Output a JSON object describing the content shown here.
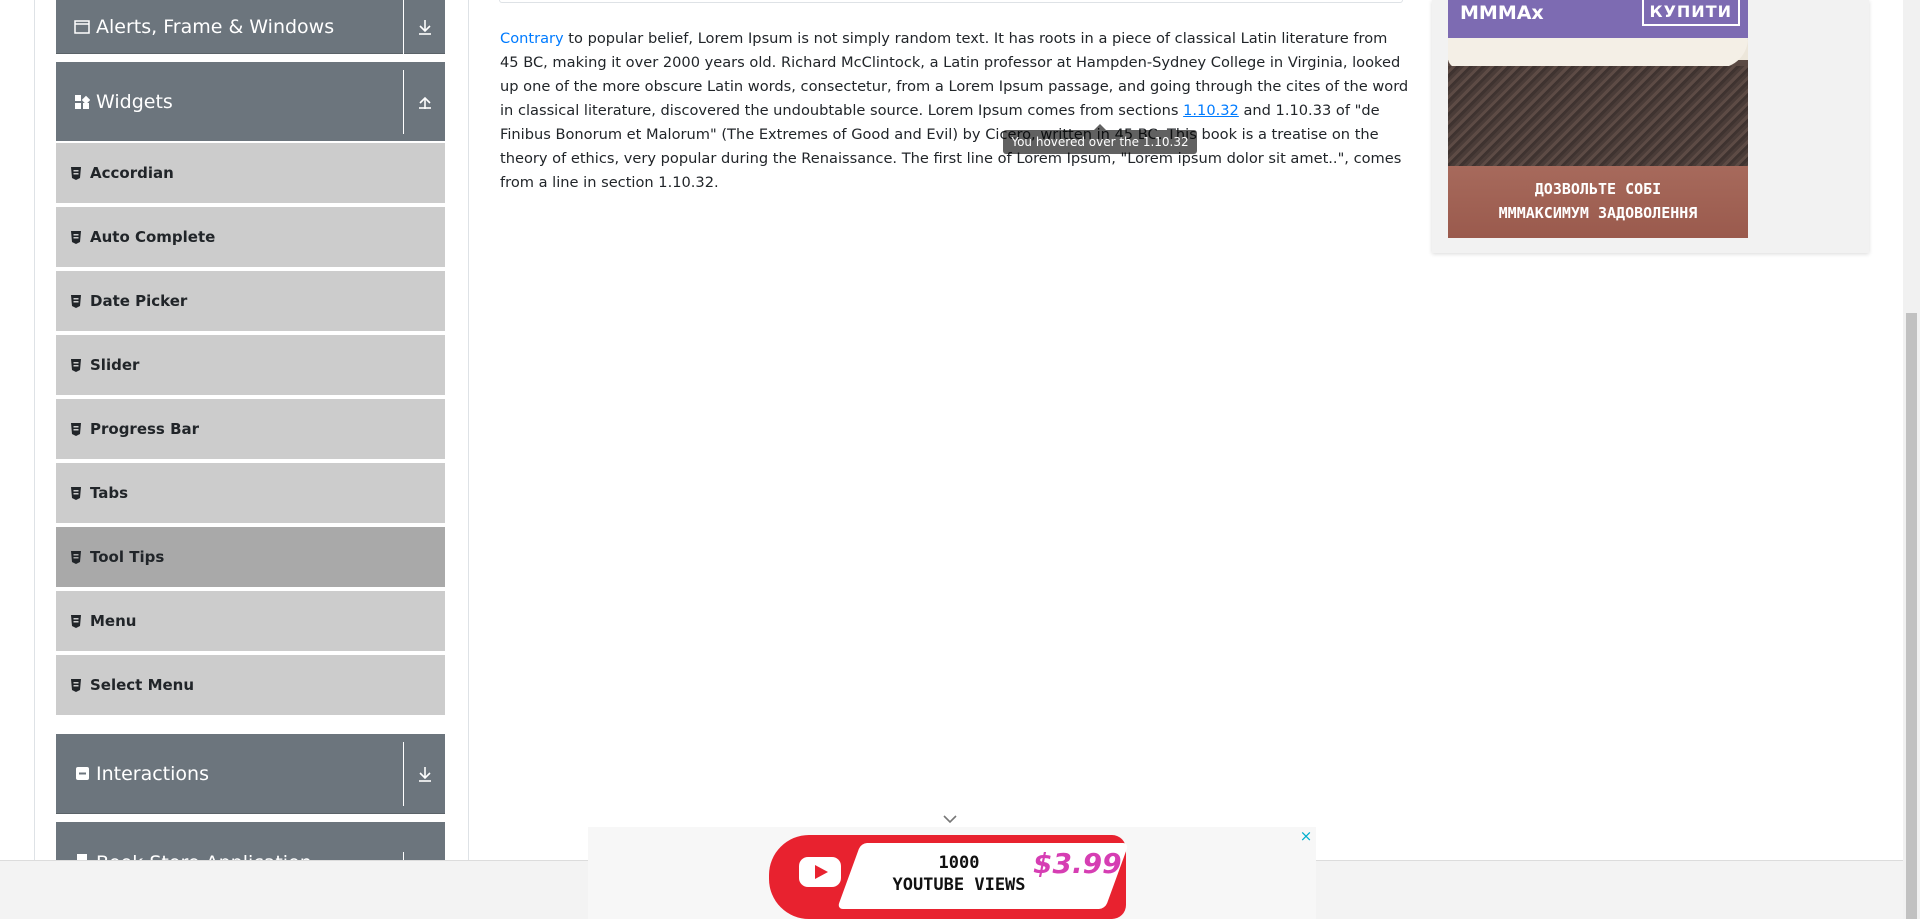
{
  "sidebar": {
    "groups": [
      {
        "label": "Alerts, Frame & Windows",
        "icon": "window-icon",
        "toggle": "expand-down-icon"
      },
      {
        "label": "Widgets",
        "icon": "widgets-icon",
        "toggle": "collapse-up-icon"
      },
      {
        "label": "Interactions",
        "icon": "interactions-icon",
        "toggle": "expand-down-icon"
      },
      {
        "label": "Book Store Application",
        "icon": "book-icon",
        "toggle": "expand-down-icon"
      }
    ],
    "items": [
      {
        "label": "Accordian"
      },
      {
        "label": "Auto Complete"
      },
      {
        "label": "Date Picker"
      },
      {
        "label": "Slider"
      },
      {
        "label": "Progress Bar"
      },
      {
        "label": "Tabs"
      },
      {
        "label": "Tool Tips",
        "active": true
      },
      {
        "label": "Menu"
      },
      {
        "label": "Select Menu"
      }
    ]
  },
  "content": {
    "blue_word": "Contrary",
    "text_before_link": " to popular belief, Lorem Ipsum is not simply random text. It has roots in a piece of classical Latin literature from 45 BC, making it over 2000 years old. Richard McClintock, a Latin professor at Hampden-Sydney College in Virginia, looked up one of the more obscure Latin words, consectetur, from a Lorem Ipsum passage, and going through the cites of the word in classical literature, discovered the undoubtable source. Lorem Ipsum comes from sections ",
    "link_text": "1.10.32",
    "text_after_link": " and 1.10.33 of \"de Finibus Bonorum et Malorum\" (The Extremes of Good and Evil) by Cicero, written in 45 BC. This book is a treatise on the theory of ethics, very popular during the Renaissance. The first line of Lorem Ipsum, \"Lorem ipsum dolor sit amet..\", comes from a line in section 1.10.32.",
    "tooltip": "You hovered over the 1.10.32"
  },
  "ad_right": {
    "brand": "MMMAx",
    "buy_label": "КУПИТИ",
    "tagline_1": "ДОЗВОЛЬТЕ СОБІ",
    "tagline_2": "МММАКСИМУМ ЗАДОВОЛЕННЯ"
  },
  "ad_bottom": {
    "line1": "1000",
    "line2": "YOUTUBE VIEWS",
    "price": "$3.99",
    "close": "×"
  },
  "colors": {
    "group_bg": "#6c757d",
    "item_bg": "#cccccc",
    "item_active_bg": "#a9a9a9",
    "link": "#007bff"
  }
}
